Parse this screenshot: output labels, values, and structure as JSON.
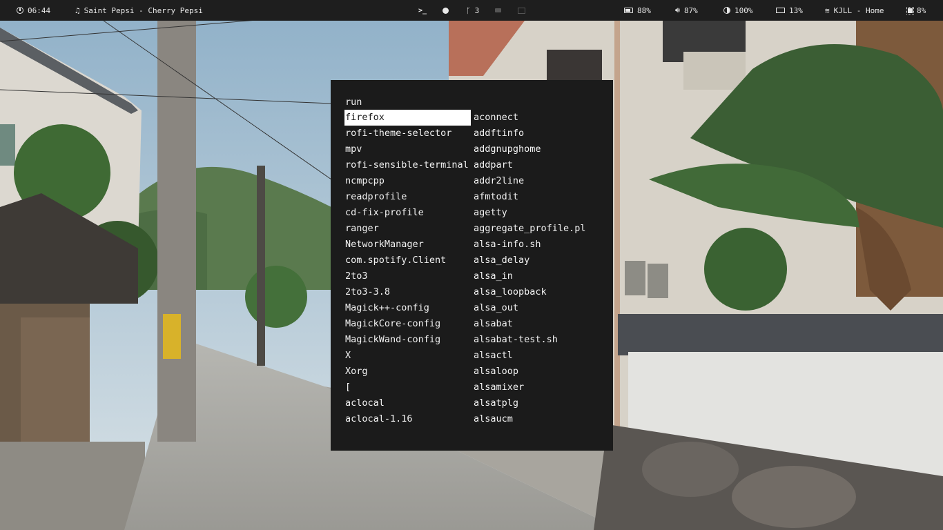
{
  "statusbar": {
    "clock": {
      "icon": "clock-icon",
      "text": "06:44"
    },
    "music": {
      "icon": "music-note-icon",
      "text": "Saint Pepsi - Cherry Pepsi"
    },
    "workspaces": [
      {
        "icon": "terminal-icon",
        "label": ""
      },
      {
        "icon": "browser-icon",
        "label": ""
      },
      {
        "icon": "git-branch-icon",
        "label": "3"
      },
      {
        "icon": "folder-icon",
        "label": ""
      },
      {
        "icon": "media-icon",
        "label": ""
      }
    ],
    "battery": {
      "icon": "battery-icon",
      "text": "88%"
    },
    "volume": {
      "icon": "speaker-icon",
      "text": "87%"
    },
    "brightness": {
      "icon": "brightness-icon",
      "text": "100%"
    },
    "memory": {
      "icon": "memory-icon",
      "text": "13%"
    },
    "wifi": {
      "icon": "wifi-icon",
      "text": "KJLL - Home"
    },
    "cpu": {
      "icon": "cpu-icon",
      "text": "8%"
    }
  },
  "launcher": {
    "prompt": "run",
    "selected_index": 0,
    "left_column": [
      "firefox",
      "rofi-theme-selector",
      "mpv",
      "rofi-sensible-terminal",
      "ncmpcpp",
      "readprofile",
      "cd-fix-profile",
      "ranger",
      "NetworkManager",
      "com.spotify.Client",
      "2to3",
      "2to3-3.8",
      "Magick++-config",
      "MagickCore-config",
      "MagickWand-config",
      "X",
      "Xorg",
      "[",
      "aclocal",
      "aclocal-1.16"
    ],
    "right_column": [
      "aconnect",
      "addftinfo",
      "addgnupghome",
      "addpart",
      "addr2line",
      "afmtodit",
      "agetty",
      "aggregate_profile.pl",
      "alsa-info.sh",
      "alsa_delay",
      "alsa_in",
      "alsa_loopback",
      "alsa_out",
      "alsabat",
      "alsabat-test.sh",
      "alsactl",
      "alsaloop",
      "alsamixer",
      "alsatplg",
      "alsaucm"
    ]
  },
  "colors": {
    "bar_bg": "#1e1e1e",
    "launcher_bg": "#1b1b1b",
    "selection_bg": "#ffffff",
    "text": "#f2f2f2"
  }
}
